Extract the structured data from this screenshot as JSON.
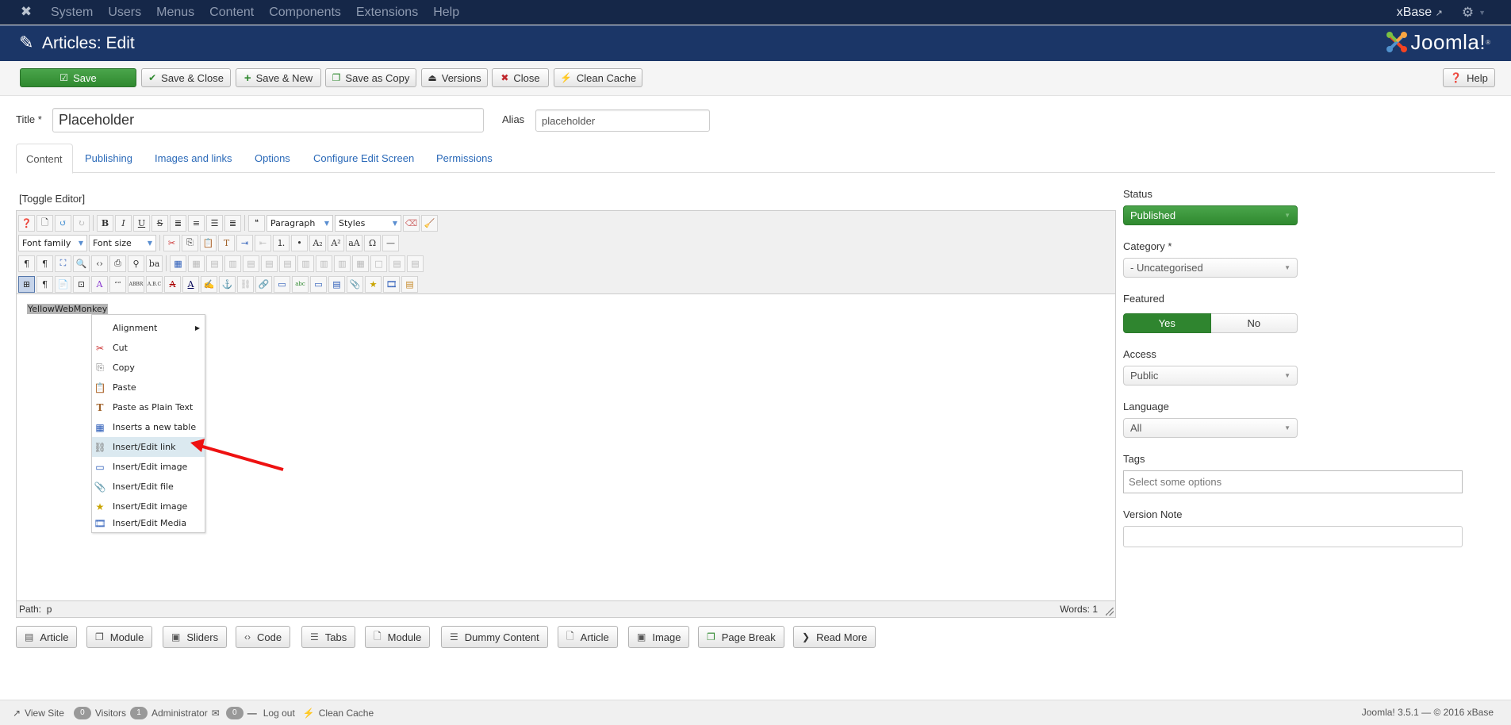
{
  "topnav": {
    "menu": [
      "System",
      "Users",
      "Menus",
      "Content",
      "Components",
      "Extensions",
      "Help"
    ],
    "site_name": "xBase",
    "icons": {
      "logo": "joomla-icon",
      "external": "external-link-icon",
      "settings": "gear-icon"
    }
  },
  "header": {
    "title": "Articles: Edit",
    "brand": "Joomla!"
  },
  "toolbar": {
    "buttons": [
      {
        "label": "Save",
        "icon": "edit-icon"
      },
      {
        "label": "Save & Close",
        "icon": "check-icon"
      },
      {
        "label": "Save & New",
        "icon": "plus-icon"
      },
      {
        "label": "Save as Copy",
        "icon": "copy-icon"
      },
      {
        "label": "Versions",
        "icon": "archive-icon"
      },
      {
        "label": "Close",
        "icon": "cancel-icon"
      },
      {
        "label": "Clean Cache",
        "icon": "lightning-icon"
      }
    ],
    "help_label": "Help"
  },
  "form": {
    "title_label": "Title *",
    "title_value": "Placeholder",
    "alias_label": "Alias",
    "alias_value": "placeholder"
  },
  "tabs": [
    "Content",
    "Publishing",
    "Images and links",
    "Options",
    "Configure Edit Screen",
    "Permissions"
  ],
  "active_tab": "Content",
  "editor": {
    "toggle_label": "[Toggle Editor]",
    "format_select": "Paragraph",
    "styles_select": "Styles",
    "font_family_select": "Font family",
    "font_size_select": "Font size",
    "content": "YellowWebMonkey",
    "path_label": "Path:",
    "path_value": "p",
    "word_count": "Words: 1"
  },
  "context_menu": {
    "items": [
      {
        "label": "Alignment",
        "icon": "",
        "submenu": true
      },
      {
        "label": "Cut",
        "icon": "scissors-icon"
      },
      {
        "label": "Copy",
        "icon": "copy-icon"
      },
      {
        "label": "Paste",
        "icon": "paste-icon"
      },
      {
        "label": "Paste as Plain Text",
        "icon": "paste-text-icon"
      },
      {
        "label": "Inserts a new table",
        "icon": "table-icon"
      },
      {
        "label": "Insert/Edit link",
        "icon": "link-icon",
        "highlighted": true
      },
      {
        "label": "Insert/Edit image",
        "icon": "image-icon"
      },
      {
        "label": "Insert/Edit file",
        "icon": "file-link-icon"
      },
      {
        "label": "Insert/Edit image",
        "icon": "image-star-icon"
      },
      {
        "label": "Insert/Edit Media",
        "icon": "film-icon"
      }
    ]
  },
  "plugin_buttons": [
    {
      "label": "Article",
      "icon": "article-icon"
    },
    {
      "label": "Module",
      "icon": "module-icon"
    },
    {
      "label": "Sliders",
      "icon": "sliders-icon"
    },
    {
      "label": "Code",
      "icon": "code-icon"
    },
    {
      "label": "Tabs",
      "icon": "tabs-icon"
    },
    {
      "label": "Module",
      "icon": "module-add-icon"
    },
    {
      "label": "Dummy Content",
      "icon": "text-icon"
    },
    {
      "label": "Article",
      "icon": "article-add-icon"
    },
    {
      "label": "Image",
      "icon": "image-icon"
    },
    {
      "label": "Page Break",
      "icon": "copy-icon"
    },
    {
      "label": "Read More",
      "icon": "chevron-down-icon"
    }
  ],
  "sidebar": {
    "status_label": "Status",
    "status_value": "Published",
    "category_label": "Category *",
    "category_value": "- Uncategorised",
    "featured_label": "Featured",
    "featured_yes": "Yes",
    "featured_no": "No",
    "featured_value": "Yes",
    "access_label": "Access",
    "access_value": "Public",
    "language_label": "Language",
    "language_value": "All",
    "tags_label": "Tags",
    "tags_placeholder": "Select some options",
    "version_note_label": "Version Note",
    "version_note_value": ""
  },
  "footer": {
    "view_site": "View Site",
    "visitors_count": "0",
    "visitors_label": "Visitors",
    "admin_count": "1",
    "admin_label": "Administrator",
    "messages_count": "0",
    "logout_label": "Log out",
    "clean_cache": "Clean Cache",
    "version": "Joomla! 3.5.1  —  © 2016 xBase"
  },
  "colors": {
    "nav_bg": "#152748",
    "header_bg": "#1b3667",
    "success": "#2f892f",
    "link": "#2a69b8",
    "annotation_arrow": "#ee1111"
  }
}
